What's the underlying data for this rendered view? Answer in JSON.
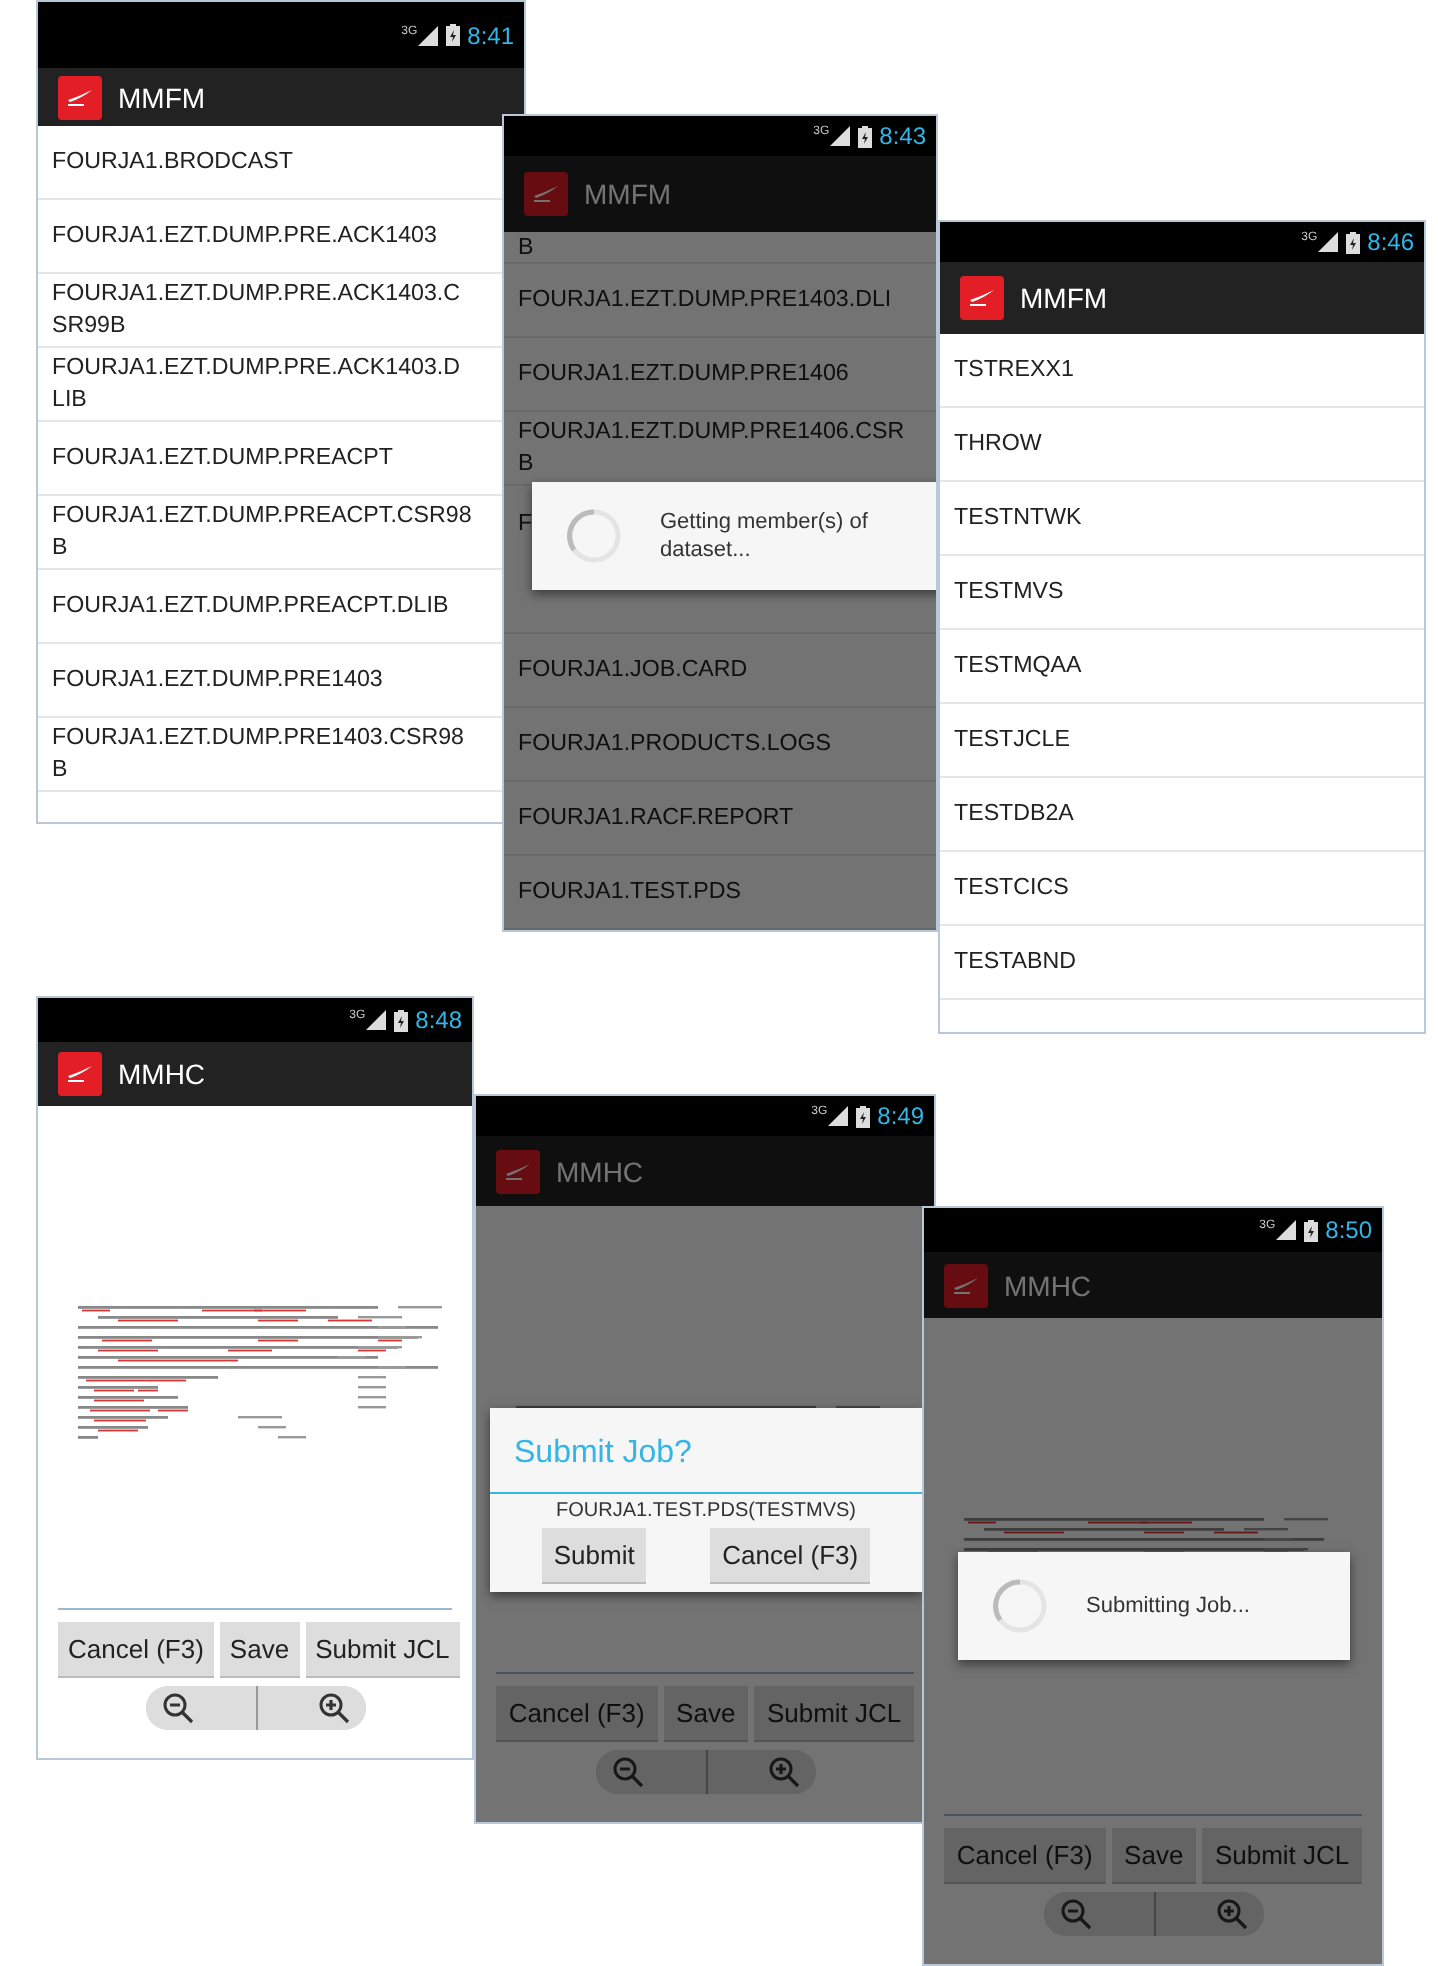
{
  "screens": [
    {
      "kind": "list",
      "network": "3G",
      "time": "8:41",
      "title": "MMFM",
      "items": [
        {
          "text": "FOURJA1.BRODCAST"
        },
        {
          "text": "FOURJA1.EZT.DUMP.PRE.ACK1403"
        },
        {
          "text": "FOURJA1.EZT.DUMP.PRE.ACK1403.C\nSR99B"
        },
        {
          "text": "FOURJA1.EZT.DUMP.PRE.ACK1403.D\nLIB"
        },
        {
          "text": "FOURJA1.EZT.DUMP.PREACPT"
        },
        {
          "text": "FOURJA1.EZT.DUMP.PREACPT.CSR98\nB"
        },
        {
          "text": "FOURJA1.EZT.DUMP.PREACPT.DLIB"
        },
        {
          "text": "FOURJA1.EZT.DUMP.PRE1403"
        },
        {
          "text": "FOURJA1.EZT.DUMP.PRE1403.CSR98\nB"
        }
      ]
    },
    {
      "kind": "list",
      "network": "3G",
      "time": "8:43",
      "title": "MMFM",
      "items": [
        {
          "text": "B"
        },
        {
          "text": "FOURJA1.EZT.DUMP.PRE1403.DLI"
        },
        {
          "text": "FOURJA1.EZT.DUMP.PRE1406"
        },
        {
          "text": "FOURJA1.EZT.DUMP.PRE1406.CSR\nB"
        },
        {
          "text": "F"
        },
        {
          "text": "FOURJA1.JOB.CARD"
        },
        {
          "text": "FOURJA1.PRODUCTS.LOGS"
        },
        {
          "text": "FOURJA1.RACF.REPORT"
        },
        {
          "text": "FOURJA1.TEST.PDS"
        }
      ],
      "dialog": {
        "kind": "progress",
        "message": "Getting member(s) of dataset..."
      }
    },
    {
      "kind": "list",
      "network": "3G",
      "time": "8:46",
      "title": "MMFM",
      "items": [
        {
          "text": "TSTREXX1"
        },
        {
          "text": "THROW"
        },
        {
          "text": "TESTNTWK"
        },
        {
          "text": "TESTMVS"
        },
        {
          "text": "TESTMQAA"
        },
        {
          "text": "TESTJCLE"
        },
        {
          "text": "TESTDB2A"
        },
        {
          "text": "TESTCICS"
        },
        {
          "text": "TESTABND"
        }
      ]
    },
    {
      "kind": "editor",
      "network": "3G",
      "time": "8:48",
      "title": "MMHC",
      "buttons": [
        "Cancel (F3)",
        "Save",
        "Submit JCL"
      ]
    },
    {
      "kind": "editor",
      "network": "3G",
      "time": "8:49",
      "title": "MMHC",
      "buttons": [
        "Cancel (F3)",
        "Save",
        "Submit JCL"
      ],
      "dialog": {
        "kind": "confirm",
        "title": "Submit Job?",
        "message": "FOURJA1.TEST.PDS(TESTMVS)",
        "buttons": [
          "Submit",
          "Cancel (F3)"
        ]
      }
    },
    {
      "kind": "editor",
      "network": "3G",
      "time": "8:50",
      "title": "MMHC",
      "buttons": [
        "Cancel (F3)",
        "Save",
        "Submit JCL"
      ],
      "dialog": {
        "kind": "progress",
        "message": "Submitting Job..."
      }
    }
  ]
}
